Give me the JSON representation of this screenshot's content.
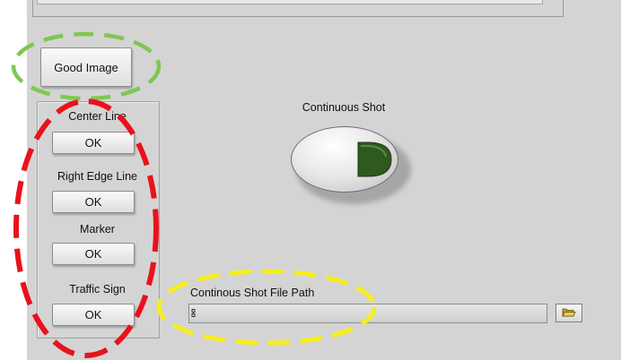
{
  "buttons": {
    "good_image": "Good Image",
    "continuous_shot_label": "Continuous Shot"
  },
  "indicators": [
    {
      "label": "Center Line",
      "status": "OK"
    },
    {
      "label": "Right Edge Line",
      "status": "OK"
    },
    {
      "label": "Marker",
      "status": "OK"
    },
    {
      "label": "Traffic Sign",
      "status": "OK"
    }
  ],
  "file_path": {
    "label": "Continous Shot File Path",
    "value": ""
  },
  "colors": {
    "panel_bg": "#d4d4d4",
    "indicator_green": "#2e5a1f",
    "highlight_green": "#7ec850",
    "highlight_red": "#e8121c",
    "highlight_yellow": "#f7ee1c"
  },
  "icons": {
    "continuous_shot_indicator": "green-d-led",
    "browse": "folder-open-icon",
    "path": "path-icon"
  }
}
